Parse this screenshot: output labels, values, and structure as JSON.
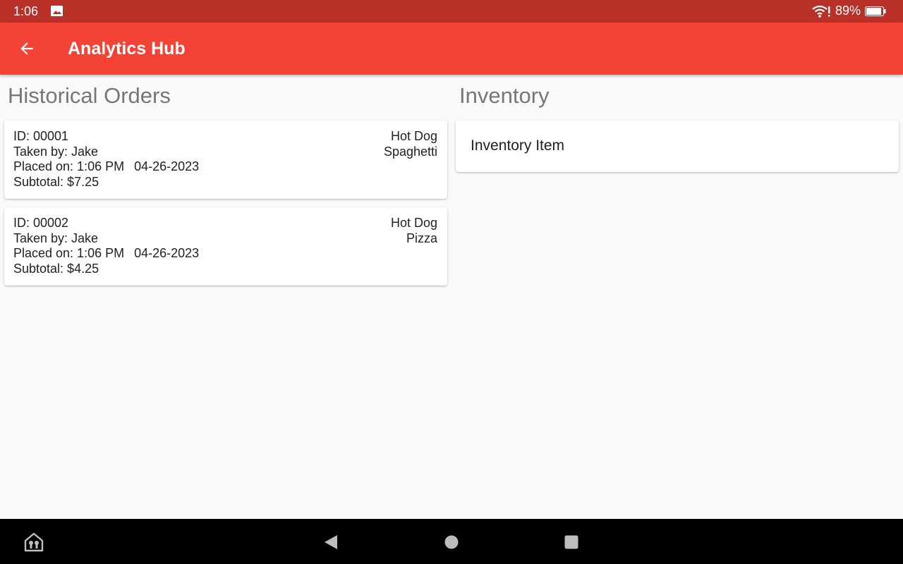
{
  "status_bar": {
    "time": "1:06",
    "battery_percent": "89%",
    "icons": [
      "image-icon",
      "wifi-alert-icon",
      "battery-icon"
    ]
  },
  "app_bar": {
    "title": "Analytics Hub",
    "back_icon": "arrow-left-icon",
    "color": "#f44336"
  },
  "historical_orders": {
    "title": "Historical Orders",
    "orders": [
      {
        "id": "ID: 00001",
        "taken_by": "Taken by: Jake",
        "placed_on_label": "Placed on: 1:06 PM",
        "date": "04-26-2023",
        "subtotal": "Subtotal: $7.25",
        "items": [
          "Hot Dog",
          "Spaghetti"
        ]
      },
      {
        "id": "ID: 00002",
        "taken_by": "Taken by: Jake",
        "placed_on_label": "Placed on: 1:06 PM",
        "date": "04-26-2023",
        "subtotal": "Subtotal: $4.25",
        "items": [
          "Hot Dog",
          "Pizza"
        ]
      }
    ]
  },
  "inventory": {
    "title": "Inventory",
    "items": [
      "Inventory Item"
    ]
  },
  "nav_bar": {
    "icons": [
      "home-assistant-icon",
      "back-triangle-icon",
      "home-circle-icon",
      "recents-square-icon"
    ]
  },
  "colors": {
    "status_bar": "#b93028",
    "app_bar": "#f44336",
    "background": "#fafafa"
  }
}
